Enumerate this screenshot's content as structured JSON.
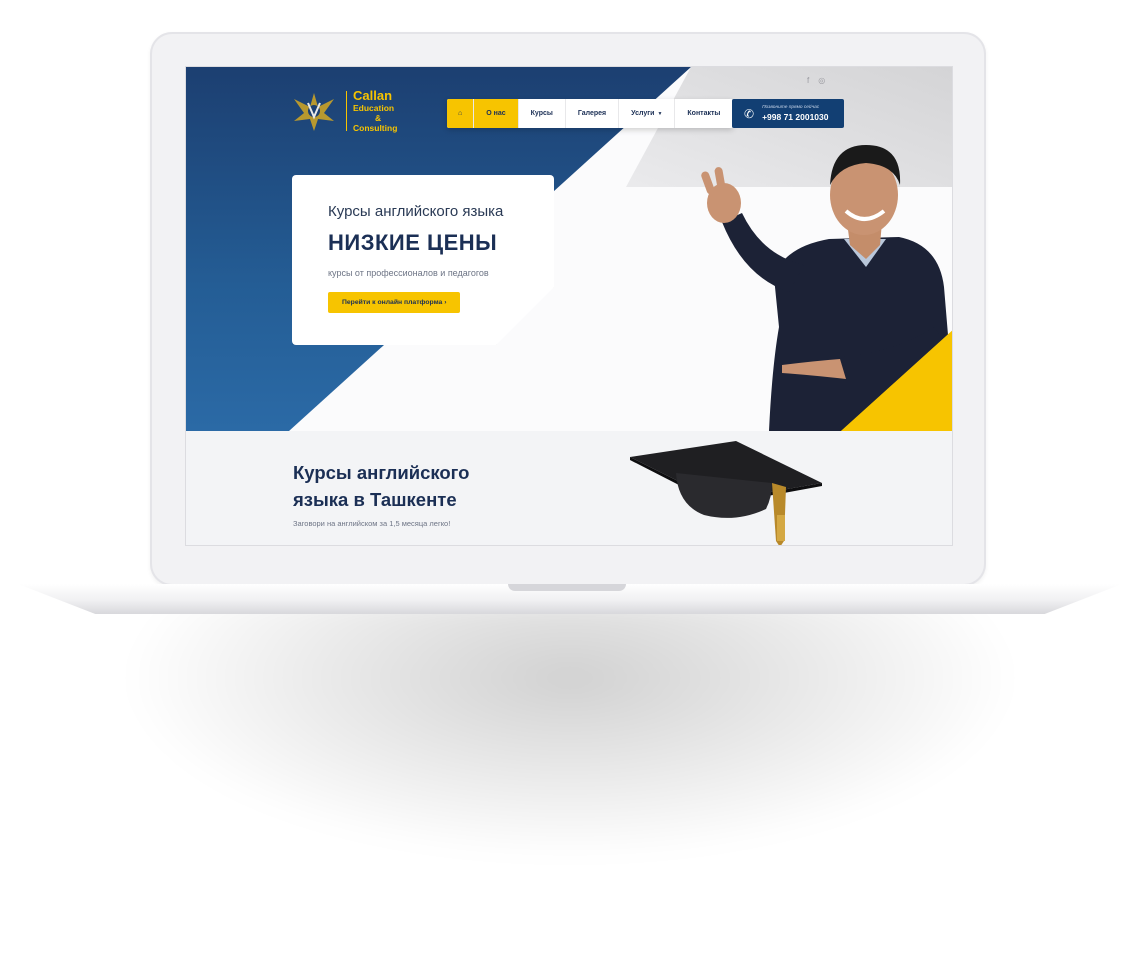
{
  "brand": {
    "line1": "Callan",
    "line2": "Education",
    "line3": "&",
    "line4": "Consulting"
  },
  "social": {
    "facebook_icon": "facebook-icon",
    "instagram_icon": "instagram-icon"
  },
  "nav": {
    "home_icon": "home-icon",
    "items": [
      {
        "label": "О нас"
      },
      {
        "label": "Курсы"
      },
      {
        "label": "Галерея"
      },
      {
        "label": "Услуги"
      },
      {
        "label": "Контакты"
      }
    ]
  },
  "call": {
    "label": "Позвоните прямо сейчас",
    "number": "+998 71 2001030",
    "icon": "phone-icon"
  },
  "hero": {
    "subtitle": "Курсы английского языка",
    "title": "НИЗКИЕ ЦЕНЫ",
    "text": "курсы от профессионалов и педагогов",
    "button_label": "Перейти к онлайн платформа",
    "button_icon": "chevron-right-icon"
  },
  "section": {
    "title_line1": "Курсы английского",
    "title_line2": "языка в Ташкенте",
    "subtitle": "Заговори на английском за 1,5 месяца легко!"
  },
  "colors": {
    "brand_blue": "#1c3f71",
    "accent_yellow": "#f7c400",
    "navy_text": "#1b2f55"
  }
}
